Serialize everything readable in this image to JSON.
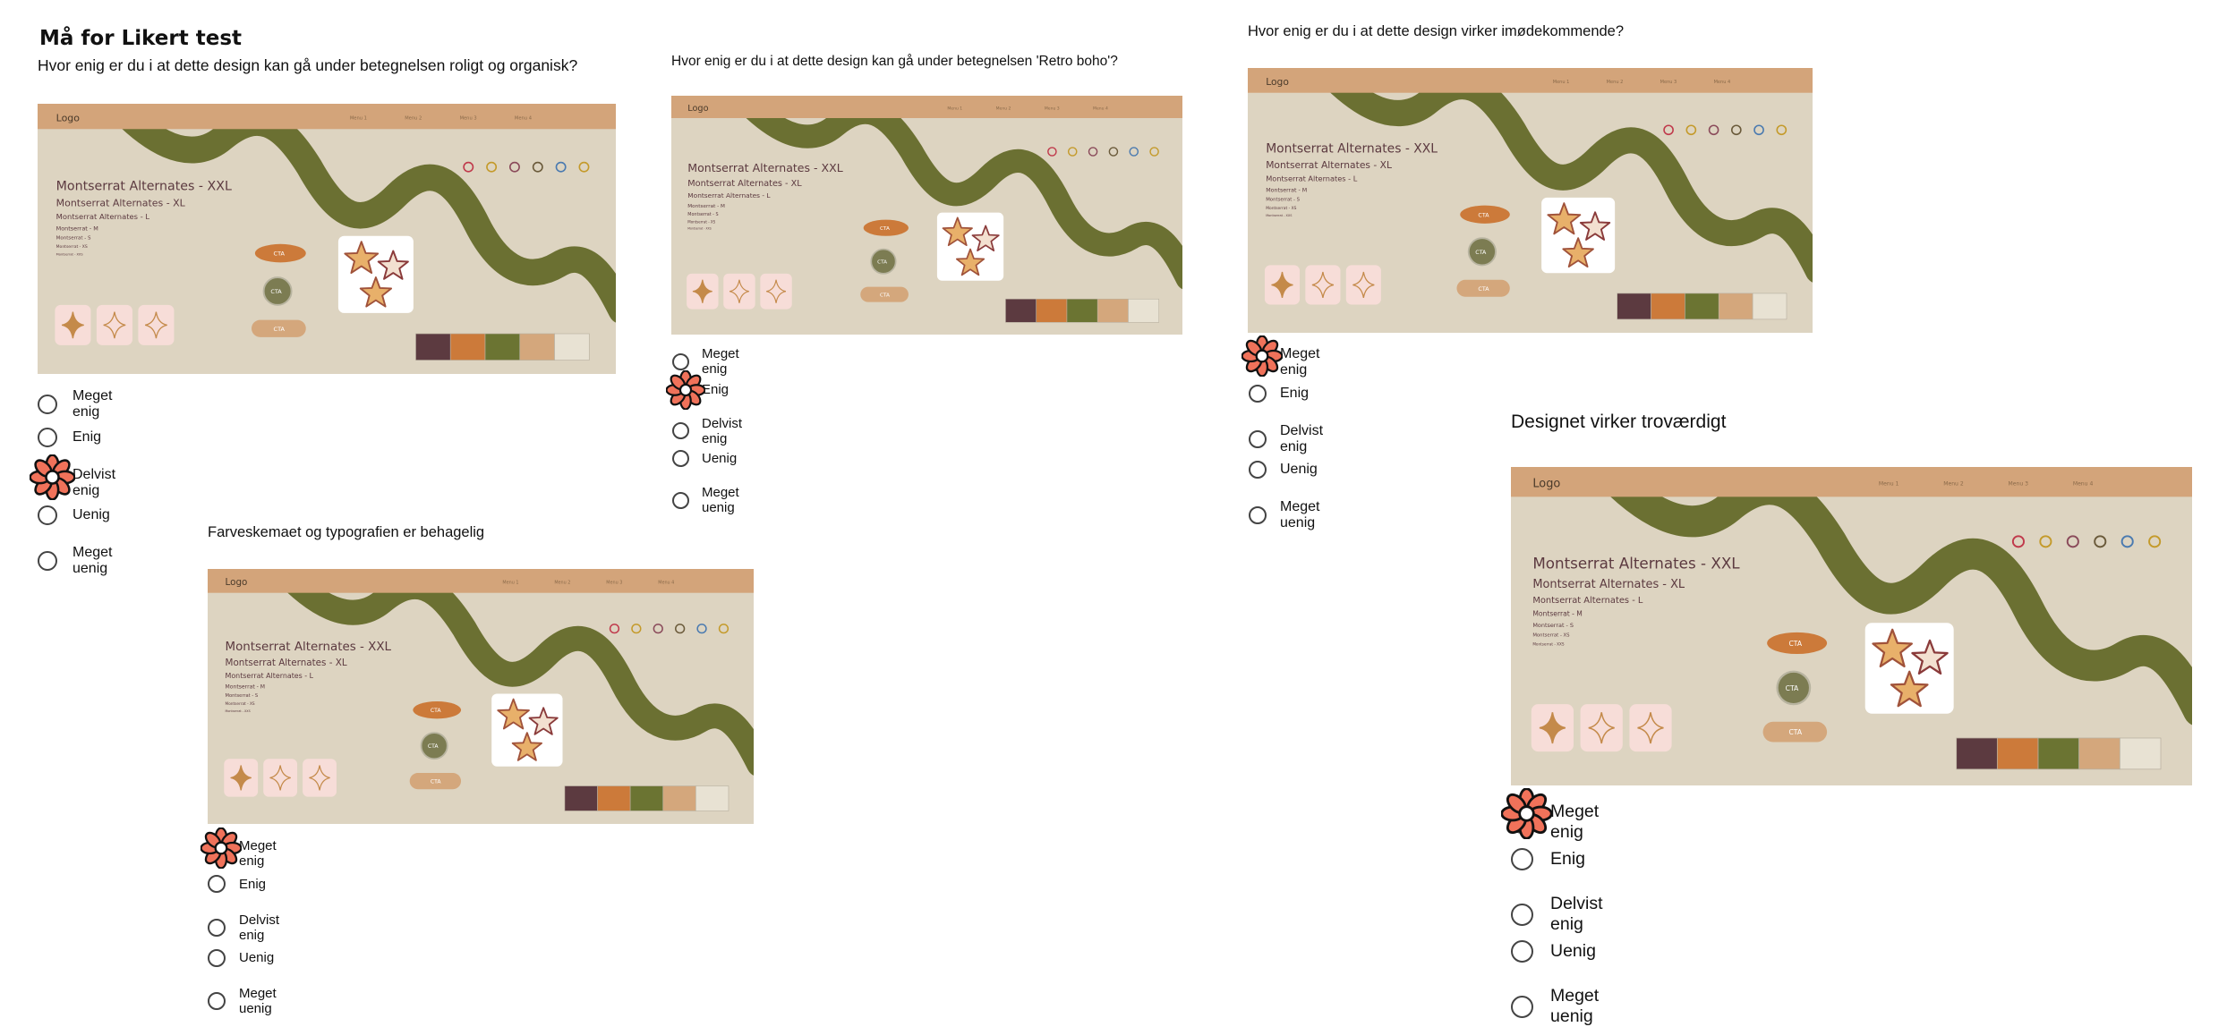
{
  "page_title": "Må for Likert test",
  "design": {
    "logo": "Logo",
    "menu": [
      "Menu 1",
      "Menu 2",
      "Menu 3",
      "Menu 4"
    ],
    "typography": [
      "Montserrat Alternates - XXL",
      "Montserrat Alternates - XL",
      "Montserrat Alternates - L",
      "Montserrat - M",
      "Montserrat - S",
      "Montserrat - XS",
      "Montserrat - XXS"
    ],
    "cta": "CTA",
    "icons": [
      "heart-icon",
      "envelope-icon",
      "flower-icon",
      "search-icon",
      "drop-icon",
      "bell-icon"
    ],
    "palette": [
      "#5c3a40",
      "#cc7a3a",
      "#6b7432",
      "#d4a77c",
      "#e8e2d3"
    ]
  },
  "questions": [
    {
      "id": "q1",
      "text": "Hvor enig er du i at dette design kan gå under betegnelsen roligt og organisk?",
      "options": [
        "Meget enig",
        "Enig",
        "Delvist enig",
        "Uenig",
        "Meget uenig"
      ],
      "selected_index": 2
    },
    {
      "id": "q2",
      "text": "Hvor enig er du i at dette design kan gå under betegnelsen 'Retro boho'?",
      "options": [
        "Meget enig",
        "Enig",
        "Delvist enig",
        "Uenig",
        "Meget uenig"
      ],
      "selected_index": 1
    },
    {
      "id": "q3",
      "text": "Hvor enig er du i at dette design virker imødekommende?",
      "options": [
        "Meget enig",
        "Enig",
        "Delvist enig",
        "Uenig",
        "Meget uenig"
      ],
      "selected_index": 0
    },
    {
      "id": "q4",
      "text": "Farveskemaet og typografien er behagelig",
      "options": [
        "Meget enig",
        "Enig",
        "Delvist enig",
        "Uenig",
        "Meget uenig"
      ],
      "selected_index": 0
    },
    {
      "id": "q5",
      "text": "Designet virker troværdigt",
      "options": [
        "Meget enig",
        "Enig",
        "Delvist enig",
        "Uenig",
        "Meget uenig"
      ],
      "selected_index": 0
    }
  ]
}
